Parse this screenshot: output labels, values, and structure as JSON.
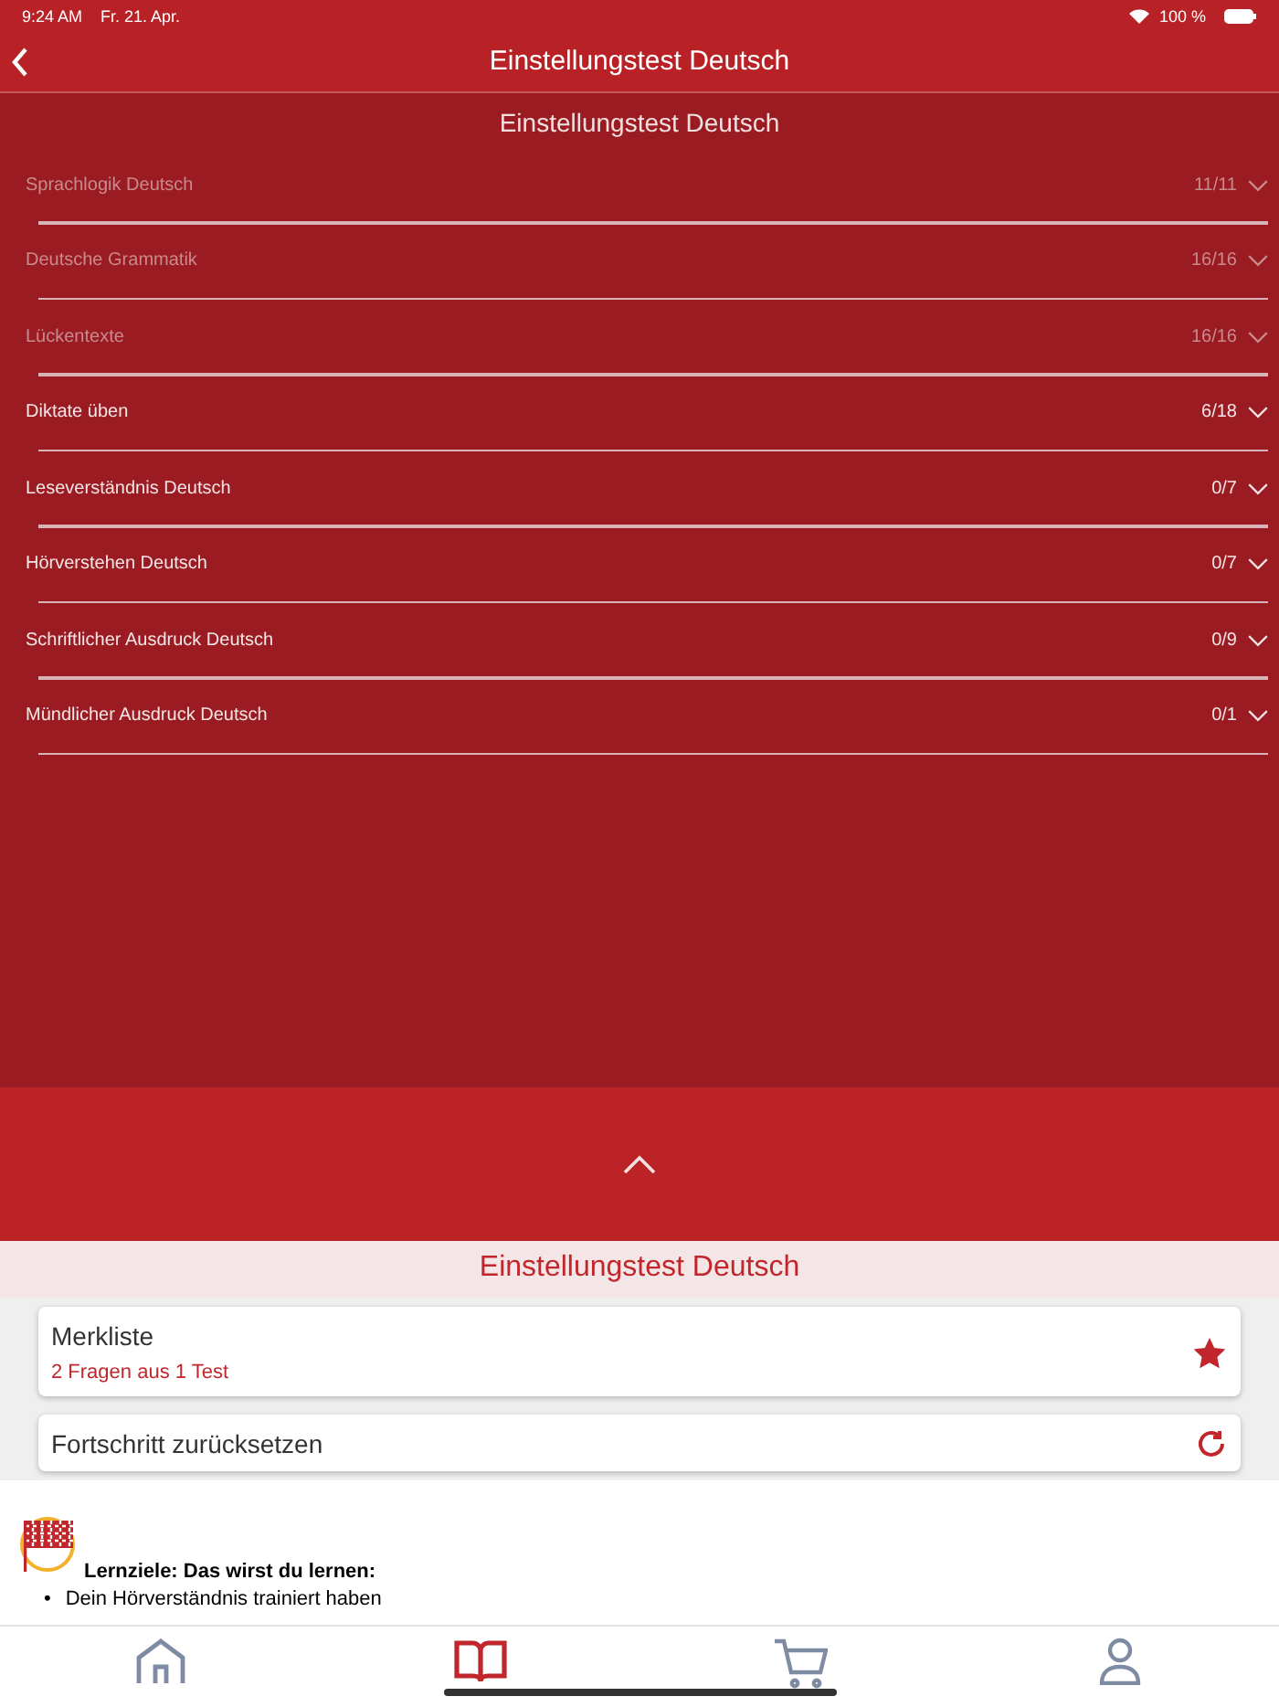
{
  "status_bar": {
    "time": "9:24 AM",
    "date": "Fr. 21. Apr.",
    "battery": "100 %"
  },
  "header": {
    "title": "Einstellungstest Deutsch"
  },
  "section": {
    "title": "Einstellungstest Deutsch",
    "rows": [
      {
        "label": "Sprachlogik Deutsch",
        "count": "11/11",
        "done": true
      },
      {
        "label": "Deutsche Grammatik",
        "count": "16/16",
        "done": true
      },
      {
        "label": "Lückentexte",
        "count": "16/16",
        "done": true
      },
      {
        "label": "Diktate üben",
        "count": "6/18",
        "done": false
      },
      {
        "label": "Leseverständnis Deutsch",
        "count": "0/7",
        "done": false
      },
      {
        "label": "Hörverstehen Deutsch",
        "count": "0/7",
        "done": false
      },
      {
        "label": "Schriftlicher Ausdruck Deutsch",
        "count": "0/9",
        "done": false
      },
      {
        "label": "Mündlicher Ausdruck Deutsch",
        "count": "0/1",
        "done": false
      }
    ]
  },
  "panel": {
    "title": "Einstellungstest Deutsch",
    "bookmarks": {
      "title": "Merkliste",
      "subtitle": "2 Fragen aus 1 Test"
    },
    "reset": {
      "title": "Fortschritt zurücksetzen"
    }
  },
  "content": {
    "heading": "Lernziele: Das wirst du lernen:",
    "bullets": [
      {
        "marker": "•",
        "text": "Dein Hörverständnis trainiert haben"
      }
    ]
  },
  "tab_bar": [
    {
      "kind": "home",
      "selected": false
    },
    {
      "kind": "book",
      "selected": true
    },
    {
      "kind": "cart",
      "selected": false
    },
    {
      "kind": "profile",
      "selected": false
    }
  ]
}
